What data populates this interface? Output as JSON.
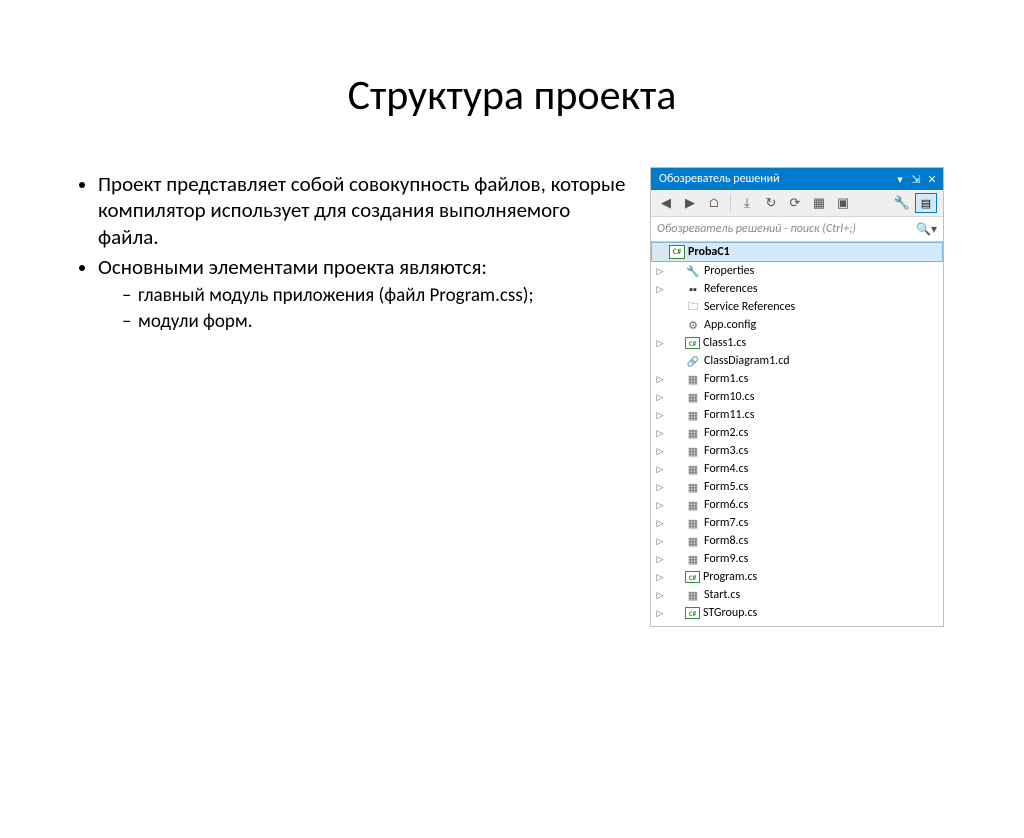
{
  "page_title": "Структура проекта",
  "bullets": {
    "b1": "Проект представляет собой совокупность файлов, которые компилятор использует для создания выполняемого файла.",
    "b2": "Основными элементами проекта являются:",
    "s1": "главный модуль приложения (файл Program.css);",
    "s2": " модули форм."
  },
  "panel": {
    "title": "Обозреватель решений",
    "search_placeholder": "Обозреватель решений - поиск (Ctrl+;)"
  },
  "tree": {
    "project": "ProbaC1",
    "n0": "Properties",
    "n1": "References",
    "n2": "Service References",
    "n3": "App.config",
    "n4": "Class1.cs",
    "n5": "ClassDiagram1.cd",
    "n6": "Form1.cs",
    "n7": "Form10.cs",
    "n8": "Form11.cs",
    "n9": "Form2.cs",
    "n10": "Form3.cs",
    "n11": "Form4.cs",
    "n12": "Form5.cs",
    "n13": "Form6.cs",
    "n14": "Form7.cs",
    "n15": "Form8.cs",
    "n16": "Form9.cs",
    "n17": "Program.cs",
    "n18": "Start.cs",
    "n19": "STGroup.cs"
  }
}
